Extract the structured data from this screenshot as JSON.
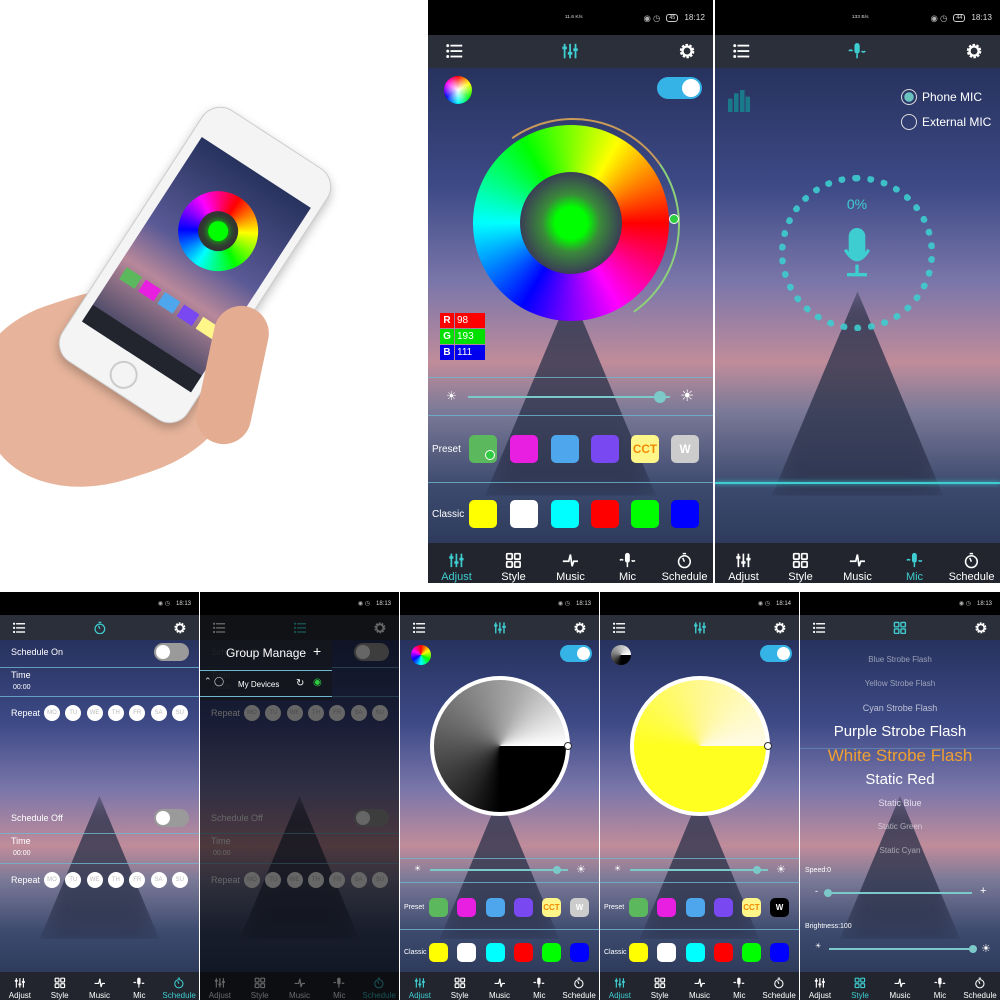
{
  "nav_labels": [
    "Adjust",
    "Style",
    "Music",
    "Mic",
    "Schedule"
  ],
  "colors": {
    "accent": "#3ecdd0",
    "toggle_on": "#35b3e6",
    "highlight": "#f0a030",
    "header": "#2b2f39"
  },
  "hand_phone": {
    "description_visible": false
  },
  "adjust_screen": {
    "status": {
      "net_speed": "11.6 K/s",
      "battery": "45",
      "time": "18:12"
    },
    "active_tab": "Adjust",
    "power_on": true,
    "rgb": {
      "r_label": "R",
      "r": "98",
      "g_label": "G",
      "g": "193",
      "b_label": "B",
      "b": "111"
    },
    "brightness_pct": 95,
    "preset_label": "Preset",
    "classic_label": "Classic",
    "preset_colors": [
      "#5cb85c",
      "#e81ee0",
      "#4ea6ec",
      "#7a48f0",
      "#fff68a",
      "#cccccc"
    ],
    "preset_texts": [
      "",
      "",
      "",
      "",
      "CCT",
      "W"
    ],
    "classic_colors": [
      "#ffff00",
      "#ffffff",
      "#00ffff",
      "#ff0000",
      "#00ff00",
      "#0000ff"
    ]
  },
  "mic_screen": {
    "status": {
      "net_speed": "133 B/s",
      "battery": "44",
      "time": "18:13"
    },
    "active_tab": "Mic",
    "phone_mic": "Phone MIC",
    "external_mic": "External MIC",
    "selected": "Phone MIC",
    "level": "0%"
  },
  "schedule_screen": {
    "status": {
      "time": "18:13"
    },
    "active_tab": "Schedule",
    "on_label": "Schedule On",
    "off_label": "Schedule Off",
    "time_label": "Time",
    "on_time": "00:00",
    "off_time": "00:00",
    "repeat_label": "Repeat",
    "days": [
      "MO",
      "TU",
      "WE",
      "TH",
      "FR",
      "SA",
      "SU"
    ]
  },
  "group_screen": {
    "status": {
      "time": "18:13"
    },
    "title": "Group Manage",
    "add": "+",
    "my_devices": "My Devices"
  },
  "adjust_gray_screen": {
    "status": {
      "time": "18:13"
    },
    "active_tab": "Adjust",
    "power_on": true,
    "brightness_pct": 92,
    "preset_label": "Preset",
    "classic_label": "Classic",
    "preset_colors": [
      "#5cb85c",
      "#e81ee0",
      "#4ea6ec",
      "#7a48f0",
      "#fff68a",
      "#cccccc"
    ],
    "preset_texts": [
      "",
      "",
      "",
      "",
      "CCT",
      "W"
    ],
    "classic_colors": [
      "#ffff00",
      "#ffffff",
      "#00ffff",
      "#ff0000",
      "#00ff00",
      "#0000ff"
    ]
  },
  "adjust_cct_screen": {
    "status": {
      "time": "18:14"
    },
    "active_tab": "Adjust",
    "power_on": true,
    "brightness_pct": 92,
    "preset_label": "Preset",
    "classic_label": "Classic",
    "preset_colors": [
      "#5cb85c",
      "#e81ee0",
      "#4ea6ec",
      "#7a48f0",
      "#fff68a",
      "#000000"
    ],
    "preset_texts": [
      "",
      "",
      "",
      "",
      "CCT",
      "W"
    ],
    "classic_colors": [
      "#ffff00",
      "#ffffff",
      "#00ffff",
      "#ff0000",
      "#00ff00",
      "#0000ff"
    ]
  },
  "style_screen": {
    "status": {
      "time": "18:13"
    },
    "active_tab": "Style",
    "styles": [
      "Blue Strobe Flash",
      "Yellow Strobe Flash",
      "Cyan Strobe Flash",
      "Purple Strobe Flash",
      "White Strobe Flash",
      "Static Red",
      "Static Blue",
      "Static Green",
      "Static Cyan"
    ],
    "selected": "White Strobe Flash",
    "speed_label": "Speed:0",
    "speed_value": 0,
    "minus": "-",
    "plus": "+",
    "brightness_label": "Brightness:100",
    "brightness_value": 100
  }
}
